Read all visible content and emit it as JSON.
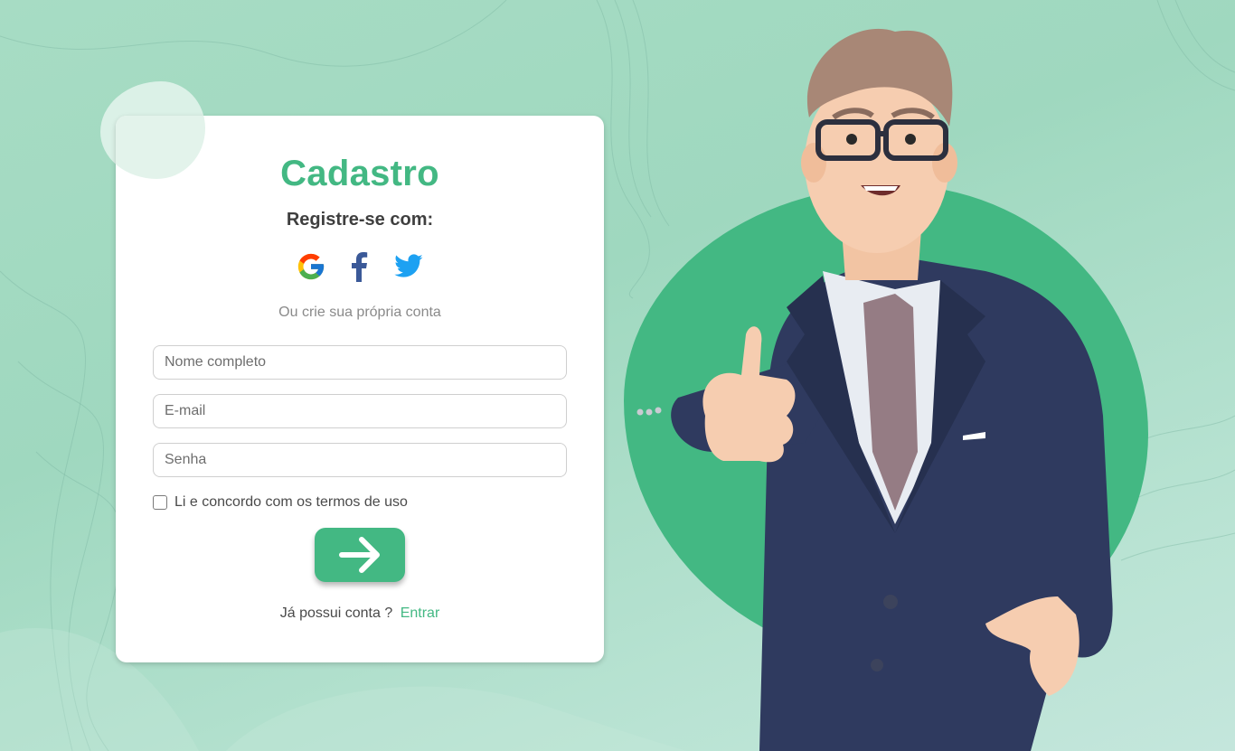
{
  "page": {
    "title": "Cadastro",
    "social_prompt": "Registre-se com:",
    "social_icons": [
      "google-icon",
      "facebook-icon",
      "twitter-icon"
    ],
    "divider_text": "Ou crie sua própria conta"
  },
  "form": {
    "name_placeholder": "Nome completo",
    "email_placeholder": "E-mail",
    "password_placeholder": "Senha",
    "terms_label": "Li e concordo com os termos de uso",
    "terms_checked": false,
    "submit_icon": "arrow-right-icon"
  },
  "footer": {
    "question": "Já possui conta ?",
    "login_link": "Entrar"
  },
  "colors": {
    "accent": "#43b883",
    "background": "#a7dcc4",
    "card": "#ffffff",
    "suit": "#2f3a5f"
  }
}
